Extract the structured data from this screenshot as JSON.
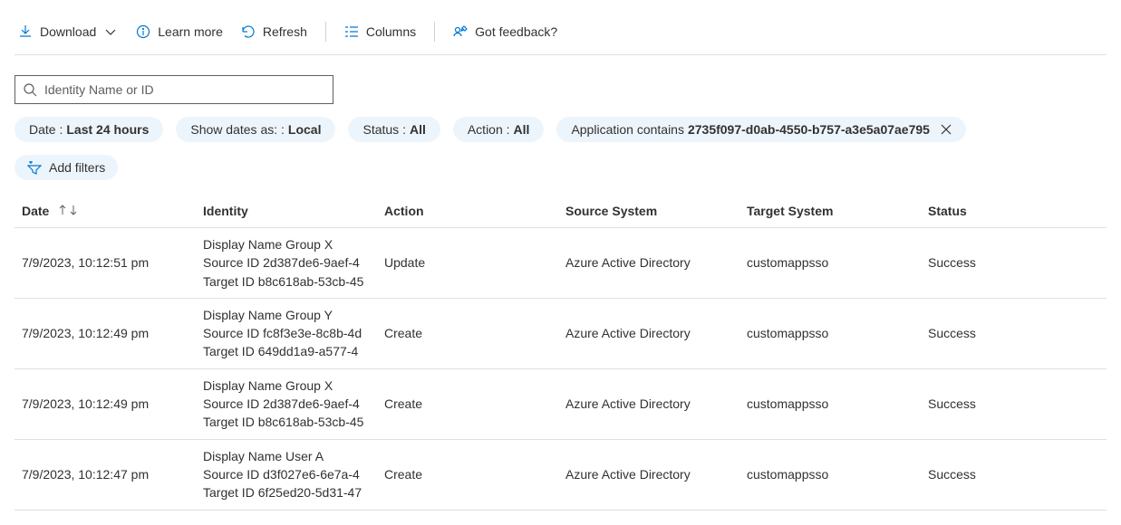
{
  "toolbar": {
    "download": "Download",
    "learn_more": "Learn more",
    "refresh": "Refresh",
    "columns": "Columns",
    "feedback": "Got feedback?"
  },
  "search": {
    "placeholder": "Identity Name or ID"
  },
  "filters": {
    "date_label": "Date : ",
    "date_value": "Last 24 hours",
    "showdates_label": "Show dates as: : ",
    "showdates_value": "Local",
    "status_label": "Status : ",
    "status_value": "All",
    "action_label": "Action : ",
    "action_value": "All",
    "app_label": "Application contains ",
    "app_value": "2735f097-d0ab-4550-b757-a3e5a07ae795",
    "add_filters": "Add filters"
  },
  "columns": {
    "date": "Date",
    "identity": "Identity",
    "action": "Action",
    "source": "Source System",
    "target": "Target System",
    "status": "Status"
  },
  "rows": [
    {
      "date": "7/9/2023, 10:12:51 pm",
      "identity_line1": "Display Name Group X",
      "identity_line2": "Source ID 2d387de6-9aef-4",
      "identity_line3": "Target ID b8c618ab-53cb-45",
      "action": "Update",
      "source": "Azure Active Directory",
      "target": "customappsso",
      "status": "Success"
    },
    {
      "date": "7/9/2023, 10:12:49 pm",
      "identity_line1": "Display Name Group Y",
      "identity_line2": "Source ID fc8f3e3e-8c8b-4d",
      "identity_line3": "Target ID 649dd1a9-a577-4",
      "action": "Create",
      "source": "Azure Active Directory",
      "target": "customappsso",
      "status": "Success"
    },
    {
      "date": "7/9/2023, 10:12:49 pm",
      "identity_line1": "Display Name Group X",
      "identity_line2": "Source ID 2d387de6-9aef-4",
      "identity_line3": "Target ID b8c618ab-53cb-45",
      "action": "Create",
      "source": "Azure Active Directory",
      "target": "customappsso",
      "status": "Success"
    },
    {
      "date": "7/9/2023, 10:12:47 pm",
      "identity_line1": "Display Name User A",
      "identity_line2": "Source ID d3f027e6-6e7a-4",
      "identity_line3": "Target ID 6f25ed20-5d31-47",
      "action": "Create",
      "source": "Azure Active Directory",
      "target": "customappsso",
      "status": "Success"
    }
  ]
}
